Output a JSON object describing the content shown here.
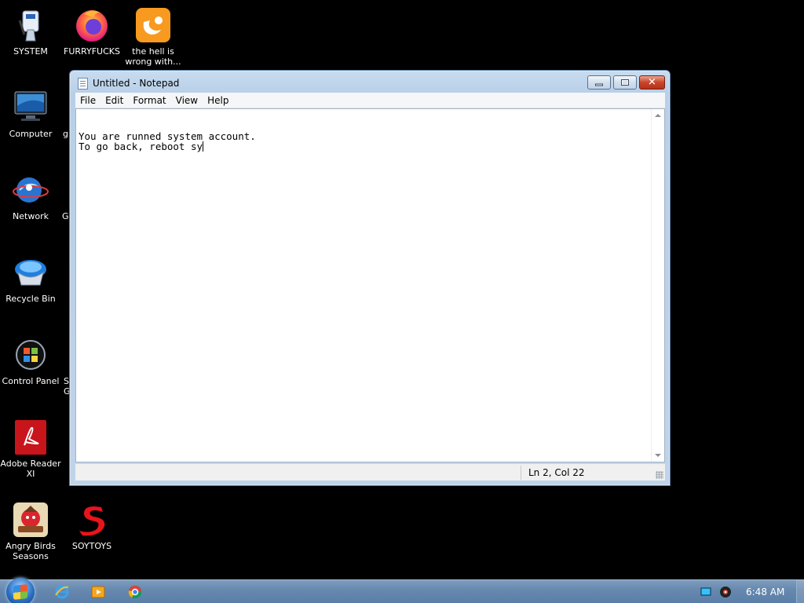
{
  "desktop": {
    "icons": [
      {
        "label": "SYSTEM",
        "icon": "system-brush-icon"
      },
      {
        "label": "FURRYFUCKS",
        "icon": "firefox-icon"
      },
      {
        "label": "the hell is wrong with...",
        "icon": "uc-browser-icon"
      },
      {
        "label": "Computer",
        "icon": "computer-icon"
      },
      {
        "label": "Network",
        "icon": "network-icon"
      },
      {
        "label": "Recycle Bin",
        "icon": "recycle-bin-icon"
      },
      {
        "label": "Control Panel",
        "icon": "control-panel-icon"
      },
      {
        "label": "Adobe Reader XI",
        "icon": "adobe-reader-icon"
      },
      {
        "label": "Angry Birds Seasons",
        "icon": "angry-birds-icon"
      },
      {
        "label": "SOYTOYS",
        "icon": "soytoys-icon"
      }
    ],
    "partial_labels": [
      "g",
      "G",
      "S",
      "G"
    ]
  },
  "notepad": {
    "title": "Untitled - Notepad",
    "menu": [
      "File",
      "Edit",
      "Format",
      "View",
      "Help"
    ],
    "content_lines": [
      "You are runned system account.",
      "To go back, reboot sy"
    ],
    "status": "Ln 2, Col 22"
  },
  "taskbar": {
    "pinned": [
      "internet-explorer-icon",
      "media-player-icon",
      "chrome-icon"
    ],
    "tray": [
      "display-icon",
      "volume-icon"
    ],
    "clock": "6:48 AM"
  },
  "colors": {
    "desktop": "#000000",
    "title_bar": "#c9dcef",
    "close_button": "#c9442b",
    "taskbar": "#6688ae"
  }
}
